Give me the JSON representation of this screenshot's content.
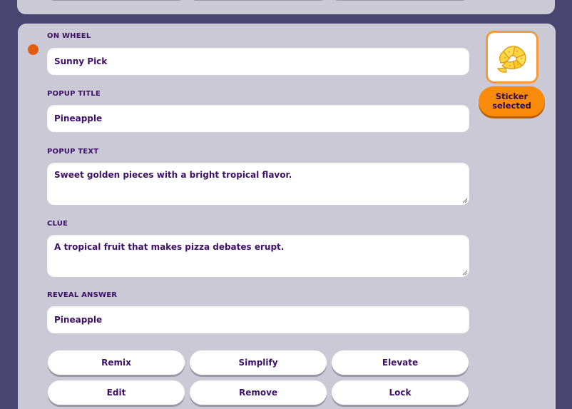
{
  "fields": {
    "on_wheel": {
      "label": "ON WHEEL",
      "value": "Sunny Pick"
    },
    "popup_title": {
      "label": "POPUP TITLE",
      "value": "Pineapple"
    },
    "popup_text": {
      "label": "POPUP TEXT",
      "value": "Sweet golden pieces with a bright tropical flavor."
    },
    "clue": {
      "label": "CLUE",
      "value": "A tropical fruit that makes pizza debates erupt."
    },
    "reveal_answer": {
      "label": "REVEAL ANSWER",
      "value": "Pineapple"
    }
  },
  "sticker": {
    "icon": "pineapple-slice-icon",
    "badge": "Sticker selected"
  },
  "actions": {
    "remix": "Remix",
    "simplify": "Simplify",
    "elevate": "Elevate",
    "edit": "Edit",
    "remove": "Remove",
    "lock": "Lock"
  },
  "colors": {
    "background": "#4a4470",
    "card": "#cbc9d6",
    "text": "#3d1168",
    "accent": "#f98b0c",
    "status_dot": "#e25d0f"
  }
}
